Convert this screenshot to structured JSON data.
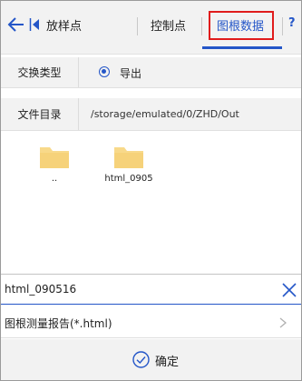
{
  "tabs": {
    "stakeout": "放样点",
    "control": "控制点",
    "traverse_data": "图根数据",
    "help": "?"
  },
  "exchange": {
    "label": "交换类型",
    "option": "导出"
  },
  "directory": {
    "label": "文件目录",
    "path": "/storage/emulated/0/ZHD/Out"
  },
  "files": [
    {
      "name": ".."
    },
    {
      "name": "html_0905"
    }
  ],
  "filename": {
    "value": "html_090516"
  },
  "file_type": {
    "label": "图根测量报告(*.html)"
  },
  "confirm": {
    "label": "确定"
  },
  "colors": {
    "accent": "#2456c8",
    "highlight_box": "#e01c1c",
    "folder": "#f8d98a"
  }
}
